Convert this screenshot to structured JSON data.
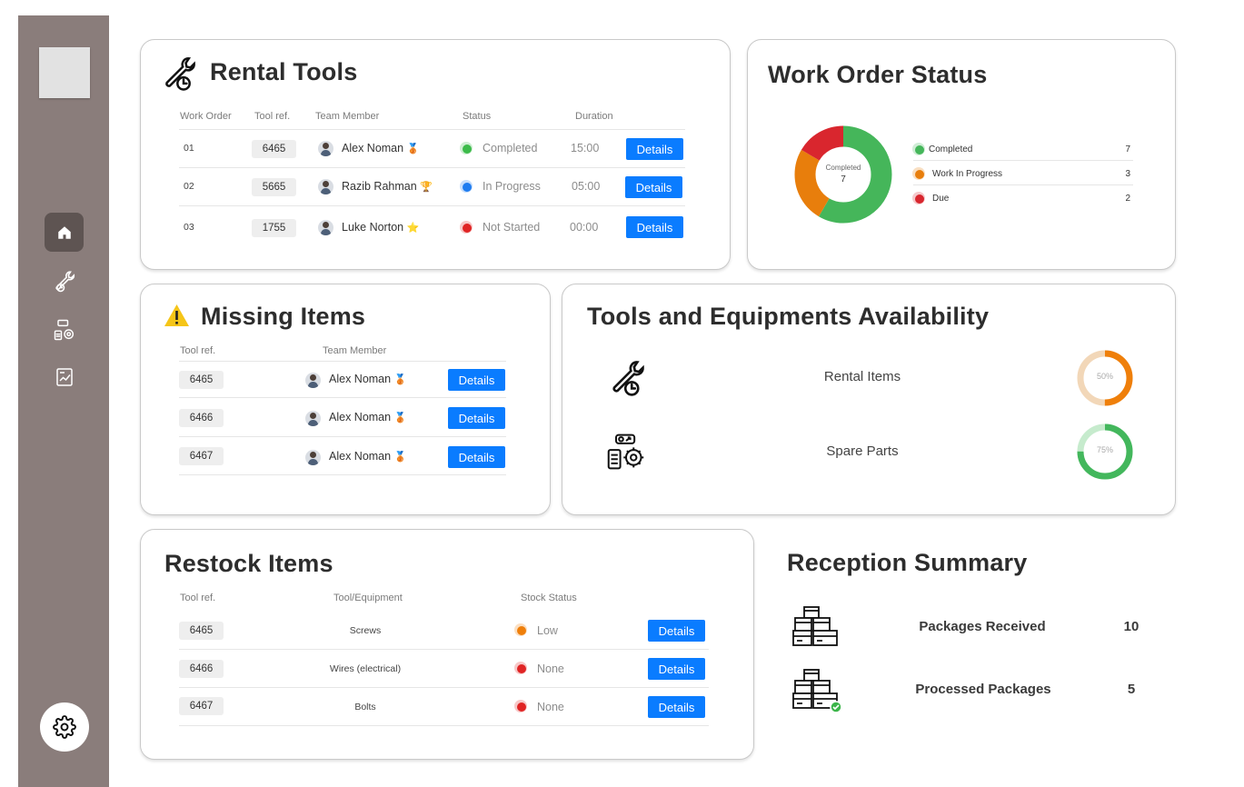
{
  "sidebar": {
    "nav": [
      {
        "icon": "home-icon",
        "active": true
      },
      {
        "icon": "tools-icon",
        "active": false
      },
      {
        "icon": "equipment-icon",
        "active": false
      },
      {
        "icon": "report-icon",
        "active": false
      }
    ],
    "settings_icon": "gear-icon"
  },
  "rental_tools": {
    "title": "Rental Tools",
    "icon": "wrench-clock-icon",
    "headers": [
      "Work Order",
      "Tool ref.",
      "Team Member",
      "Status",
      "Duration"
    ],
    "rows": [
      {
        "order": "01",
        "ref": "6465",
        "member": "Alex Noman",
        "badge": "🥉",
        "status": "Completed",
        "status_color": "#3dbb4a",
        "duration": "15:00",
        "action": "Details"
      },
      {
        "order": "02",
        "ref": "5665",
        "member": "Razib Rahman",
        "badge": "🏆",
        "status": "In Progress",
        "status_color": "#1e7cf0",
        "duration": "05:00",
        "action": "Details"
      },
      {
        "order": "03",
        "ref": "1755",
        "member": "Luke Norton",
        "badge": "⭐",
        "status": "Not Started",
        "status_color": "#e02424",
        "duration": "00:00",
        "action": "Details"
      }
    ]
  },
  "work_order_status": {
    "title": "Work Order Status",
    "center_label": "Completed",
    "center_value": "7",
    "legend": [
      {
        "label": "Completed",
        "value": "7",
        "color": "#45b65a"
      },
      {
        "label": "Work In Progress",
        "value": "3",
        "color": "#e87e0c"
      },
      {
        "label": "Due",
        "value": "2",
        "color": "#d9262e"
      }
    ]
  },
  "chart_data": {
    "type": "pie",
    "categories": [
      "Completed",
      "Work In Progress",
      "Due"
    ],
    "values": [
      7,
      3,
      2
    ],
    "colors": [
      "#45b65a",
      "#e87e0c",
      "#d9262e"
    ],
    "title": "Work Order Status",
    "legend": "right"
  },
  "missing_items": {
    "title": "Missing Items",
    "icon": "warning-icon",
    "headers": [
      "Tool ref.",
      "Team Member"
    ],
    "rows": [
      {
        "ref": "6465",
        "member": "Alex Noman",
        "badge": "🥉",
        "action": "Details"
      },
      {
        "ref": "6466",
        "member": "Alex Noman",
        "badge": "🥉",
        "action": "Details"
      },
      {
        "ref": "6467",
        "member": "Alex Noman",
        "badge": "🥉",
        "action": "Details"
      }
    ]
  },
  "availability": {
    "title": "Tools and Equipments Availability",
    "items": [
      {
        "icon": "wrench-clock-icon",
        "label": "Rental Items",
        "percent": 50,
        "percent_label": "50%",
        "color": "#ef7f0a",
        "track": "#f2d7b8"
      },
      {
        "icon": "gear-parts-icon",
        "label": "Spare Parts",
        "percent": 75,
        "percent_label": "75%",
        "color": "#43b75c",
        "track": "#c6ebcd"
      }
    ]
  },
  "restock_items": {
    "title": "Restock Items",
    "headers": [
      "Tool ref.",
      "Tool/Equipment",
      "Stock Status"
    ],
    "rows": [
      {
        "ref": "6465",
        "name": "Screws",
        "stock": "Low",
        "stock_color": "#ef7f0a",
        "action": "Details"
      },
      {
        "ref": "6466",
        "name": "Wires (electrical)",
        "stock": "None",
        "stock_color": "#e02424",
        "action": "Details"
      },
      {
        "ref": "6467",
        "name": "Bolts",
        "stock": "None",
        "stock_color": "#e02424",
        "action": "Details"
      }
    ]
  },
  "reception_summary": {
    "title": "Reception Summary",
    "items": [
      {
        "icon": "packages-icon",
        "label": "Packages Received",
        "value": "10"
      },
      {
        "icon": "packages-check-icon",
        "label": "Processed Packages",
        "value": "5"
      }
    ]
  }
}
